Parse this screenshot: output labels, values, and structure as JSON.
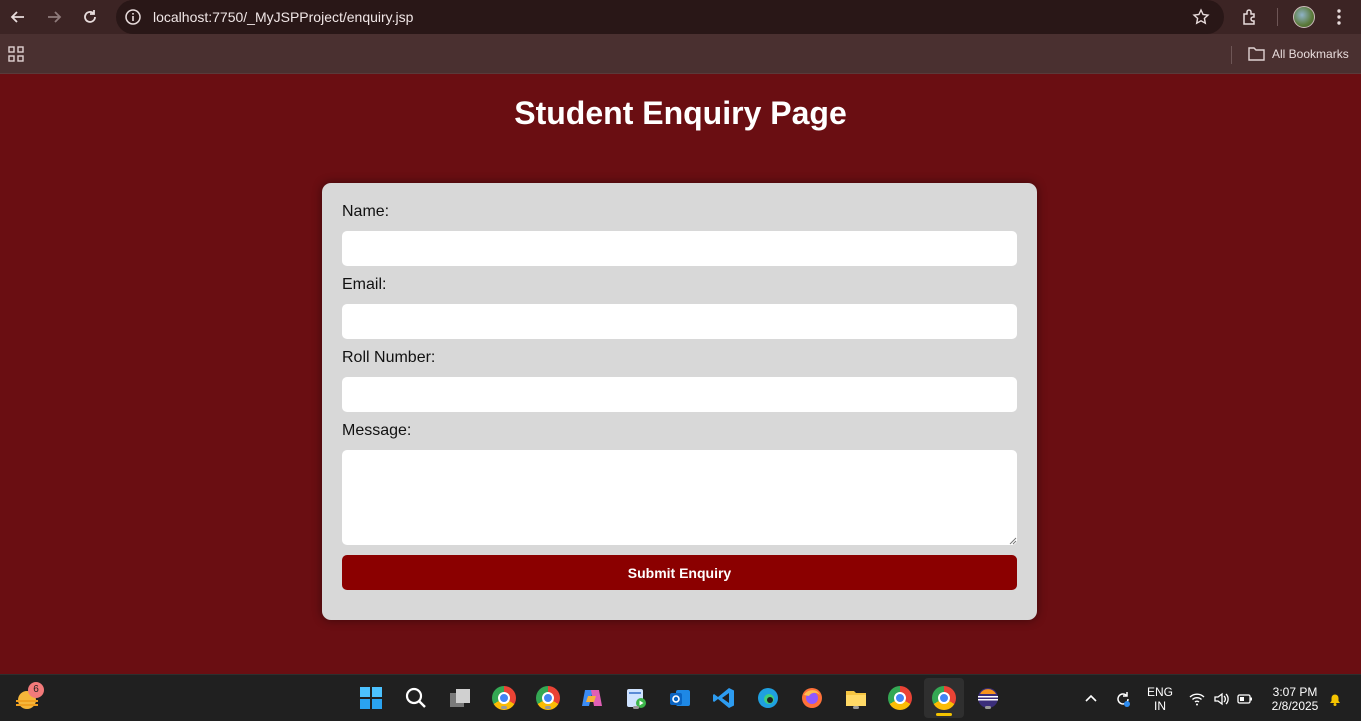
{
  "browser": {
    "url": "localhost:7750/_MyJSPProject/enquiry.jsp",
    "bookmarks_label": "All Bookmarks"
  },
  "page": {
    "title": "Student Enquiry Page",
    "form": {
      "name_label": "Name:",
      "email_label": "Email:",
      "roll_label": "Roll Number:",
      "message_label": "Message:",
      "name_value": "",
      "email_value": "",
      "roll_value": "",
      "message_value": "",
      "submit_label": "Submit Enquiry"
    }
  },
  "taskbar": {
    "weather_badge": "6",
    "language_line1": "ENG",
    "language_line2": "IN",
    "time": "3:07 PM",
    "date": "2/8/2025"
  },
  "colors": {
    "page_background": "#6a0e12",
    "card_background": "#d8d8d8",
    "button_background": "#8b0000"
  }
}
